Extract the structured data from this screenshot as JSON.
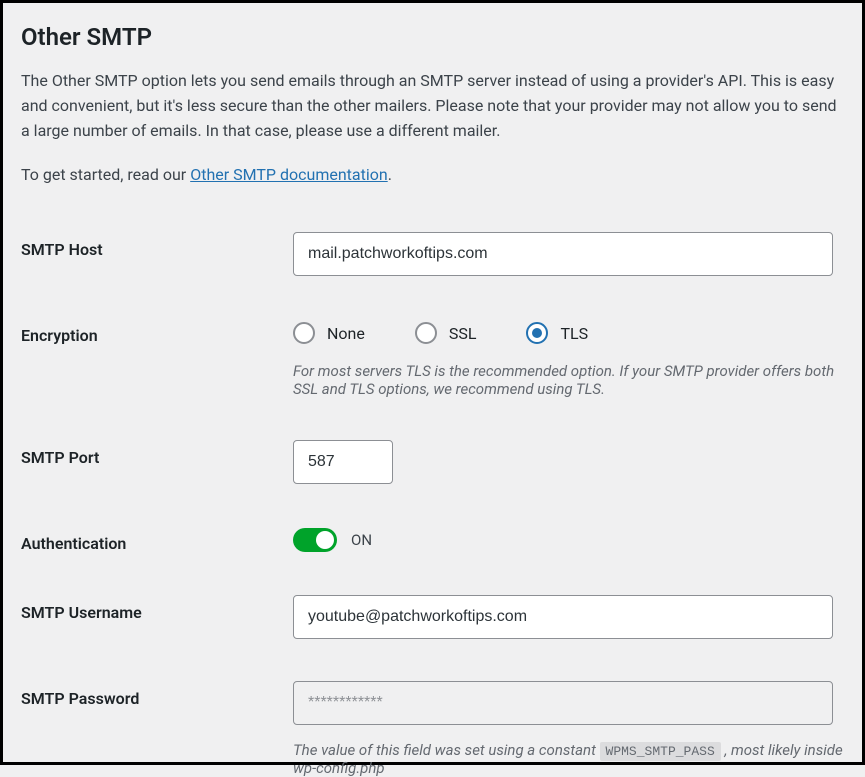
{
  "title": "Other SMTP",
  "description": "The Other SMTP option lets you send emails through an SMTP server instead of using a provider's API. This is easy and convenient, but it's less secure than the other mailers. Please note that your provider may not allow you to send a large number of emails. In that case, please use a different mailer.",
  "intro": {
    "prefix": "To get started, read our ",
    "link_text": "Other SMTP documentation",
    "suffix": "."
  },
  "fields": {
    "host": {
      "label": "SMTP Host",
      "value": "mail.patchworkoftips.com"
    },
    "encryption": {
      "label": "Encryption",
      "options": {
        "none": "None",
        "ssl": "SSL",
        "tls": "TLS"
      },
      "help": "For most servers TLS is the recommended option. If your SMTP provider offers both SSL and TLS options, we recommend using TLS."
    },
    "port": {
      "label": "SMTP Port",
      "value": "587"
    },
    "auth": {
      "label": "Authentication",
      "state": "ON"
    },
    "username": {
      "label": "SMTP Username",
      "value": "youtube@patchworkoftips.com"
    },
    "password": {
      "label": "SMTP Password",
      "value": "************",
      "note_prefix": "The value of this field was set using a constant ",
      "note_code": "WPMS_SMTP_PASS",
      "note_suffix": " , most likely inside wp-config.php"
    }
  }
}
